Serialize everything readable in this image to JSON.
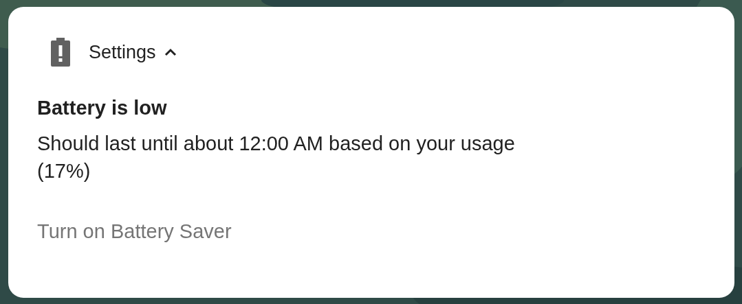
{
  "notification": {
    "app_name": "Settings",
    "expanded": true,
    "title": "Battery is low",
    "body": "Should last until about 12:00 AM based on your usage (17%)",
    "actions": [
      "Turn on Battery Saver"
    ]
  }
}
